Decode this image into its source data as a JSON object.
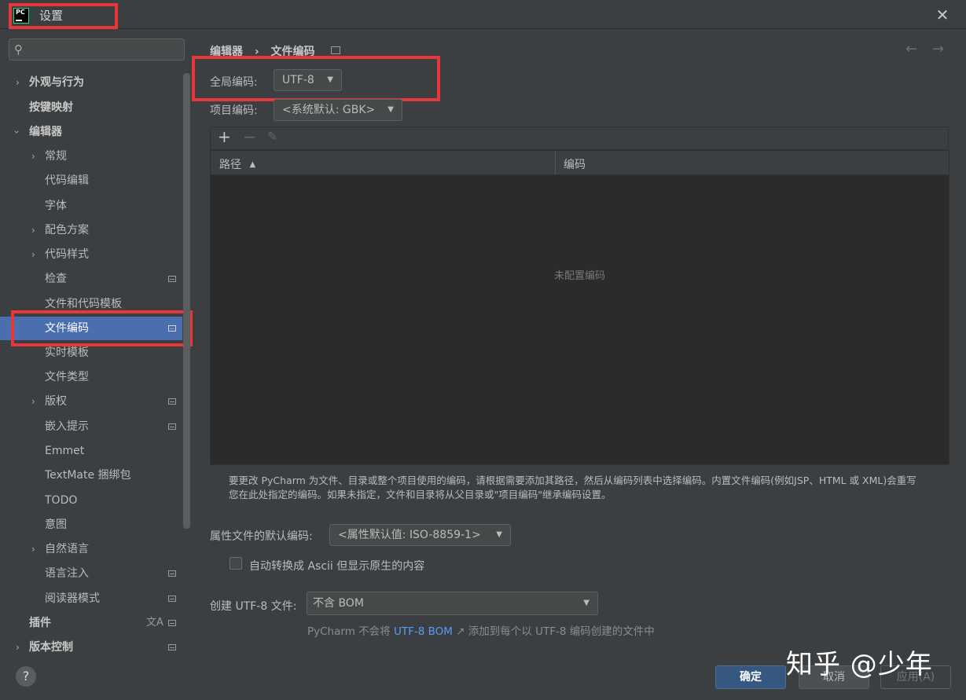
{
  "window": {
    "title": "设置",
    "logo_text": "PC"
  },
  "sidebar": {
    "search_placeholder": "",
    "items": [
      {
        "label": "外观与行为"
      },
      {
        "label": "按键映射"
      },
      {
        "label": "编辑器"
      },
      {
        "label": "常规"
      },
      {
        "label": "代码编辑"
      },
      {
        "label": "字体"
      },
      {
        "label": "配色方案"
      },
      {
        "label": "代码样式"
      },
      {
        "label": "检查"
      },
      {
        "label": "文件和代码模板"
      },
      {
        "label": "文件编码"
      },
      {
        "label": "实时模板"
      },
      {
        "label": "文件类型"
      },
      {
        "label": "版权"
      },
      {
        "label": "嵌入提示"
      },
      {
        "label": "Emmet"
      },
      {
        "label": "TextMate 捆绑包"
      },
      {
        "label": "TODO"
      },
      {
        "label": "意图"
      },
      {
        "label": "自然语言"
      },
      {
        "label": "语言注入"
      },
      {
        "label": "阅读器模式"
      },
      {
        "label": "插件"
      },
      {
        "label": "版本控制"
      }
    ],
    "selected": "文件编码"
  },
  "breadcrumb": {
    "parent": "编辑器",
    "separator": "›",
    "current": "文件编码"
  },
  "global_encoding": {
    "label": "全局编码:",
    "value": "UTF-8"
  },
  "project_encoding": {
    "label": "项目编码:",
    "value": "<系统默认: GBK>"
  },
  "table": {
    "columns": [
      "路径",
      "编码"
    ],
    "sort_indicator": "▲",
    "empty_text": "未配置编码"
  },
  "description": {
    "line1": "要更改 PyCharm 为文件、目录或整个项目使用的编码，请根据需要添加其路径，然后从编码列表中选择编码。内置文件编码(例如JSP、HTML 或 XML)会重写",
    "line2": "您在此处指定的编码。如果未指定，文件和目录将从父目录或\"项目编码\"继承编码设置。"
  },
  "properties_encoding": {
    "label": "属性文件的默认编码:",
    "value": "<属性默认值: ISO-8859-1>"
  },
  "ascii_checkbox": {
    "label": "自动转换成 Ascii 但显示原生的内容",
    "checked": false
  },
  "bom": {
    "label": "创建 UTF-8 文件:",
    "value": "不含 BOM",
    "hint_prefix": "PyCharm 不会将",
    "hint_link": "UTF-8 BOM",
    "hint_suffix": "添加到每个以 UTF-8 编码创建的文件中"
  },
  "buttons": {
    "ok": "确定",
    "cancel": "取消",
    "apply": "应用(A)"
  },
  "help": "?",
  "watermark": "知乎 @少年",
  "colors": {
    "accent": "#4b6eaf",
    "primary_button": "#365880",
    "highlight_box": "#e8373a",
    "link": "#589df6"
  }
}
